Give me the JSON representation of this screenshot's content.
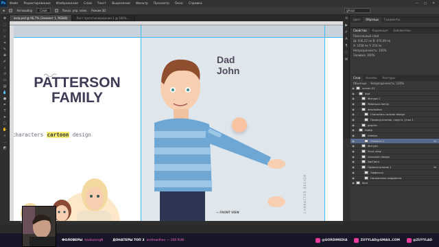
{
  "app": {
    "logo": "Ps"
  },
  "menu": [
    "Файл",
    "Редактирование",
    "Изображение",
    "Слои",
    "Текст",
    "Выделение",
    "Фильтр",
    "Просмотр",
    "Окно",
    "Справка"
  ],
  "window_controls": [
    "—",
    "▢",
    "✕"
  ],
  "options": {
    "checkbox_label": "Автовыбор",
    "dropdown": "Слой",
    "transform_label": "Показ. упр. элем.",
    "align_label": "Режим 3D",
    "search": "gfrozz"
  },
  "tabs": [
    {
      "label": "lesla.psd @ 66,7% (Элемент 1, RGB/8)",
      "active": true
    },
    {
      "label": "Лист прототипирования 1 @ 100% ...",
      "active": false
    }
  ],
  "artboard_left": {
    "title": "PATTERSON FAMILY",
    "subtitle_pre": "characters ",
    "subtitle_hl": "cartoon",
    "subtitle_post": " design"
  },
  "artboard_right": {
    "name_line1": "Dad",
    "name_line2": "John",
    "front_view": "— FRONT VIEW",
    "vertical_label": "CHARACTER DESIGN",
    "swatch_color": "#fac3a3"
  },
  "right_panels": {
    "top_tabs": [
      "Цвет",
      "Образцы",
      "Градиенты"
    ],
    "props_tabs": [
      "Свойства",
      "Коррекция",
      "Библиотеки"
    ],
    "props_rows": [
      "Пиксельный слой",
      "Ш: 636,22 пк   В: 474,09 пк",
      "X: 1058 пк   Y: 254 пк",
      "Непрозрачность: 100%",
      "Заливка: 100%"
    ],
    "layers_tabs": [
      "Слои",
      "Каналы",
      "Контуры"
    ],
    "blend_mode": "Обычные",
    "opacity": "Непрозрачность: 100%",
    "layers": [
      {
        "name": "screen 01",
        "selected": false,
        "fx": false
      },
      {
        "name": "dad",
        "selected": false,
        "fx": false
      },
      {
        "name": "Фигура 1",
        "selected": false,
        "fx": false
      },
      {
        "name": "Patterson family",
        "selected": false,
        "fx": false
      },
      {
        "name": "description",
        "selected": false,
        "fx": false
      },
      {
        "name": "Characters cartoon design",
        "selected": false,
        "fx": false
      },
      {
        "name": "Прямоугольник, скругл. углы 1",
        "selected": false,
        "fx": false
      },
      {
        "name": "graphic",
        "selected": false,
        "fx": false
      },
      {
        "name": "Кайф",
        "selected": false,
        "fx": false
      },
      {
        "name": "наверх",
        "selected": false,
        "fx": false
      },
      {
        "name": "Элемент 1",
        "selected": true,
        "fx": true
      },
      {
        "name": "Фигура",
        "selected": false,
        "fx": false
      },
      {
        "name": "Front view",
        "selected": false,
        "fx": false
      },
      {
        "name": "character design",
        "selected": false,
        "fx": false
      },
      {
        "name": "Dad John",
        "selected": false,
        "fx": false
      },
      {
        "name": "Прямоугольник 1",
        "selected": false,
        "fx": true
      },
      {
        "name": "Эффекты",
        "selected": false,
        "fx": false
      },
      {
        "name": "Наложение градиента",
        "selected": false,
        "fx": false
      },
      {
        "name": "Фон",
        "selected": false,
        "fx": false
      }
    ]
  },
  "status": "66,67%   Док: 4,29M/340,8M",
  "bottom": {
    "followers_label": "ФОЛОВЕРЫ",
    "followers_value": "hadoukingN",
    "donators_label": "ДОНАТЕРЫ ТОП 3",
    "donators_value": "andrewdhev — 100 RUB",
    "socials": [
      "@GORDIMEDIA",
      "ZUYYLAD@GMAIL.COM",
      "@ZUYYLAD"
    ]
  }
}
